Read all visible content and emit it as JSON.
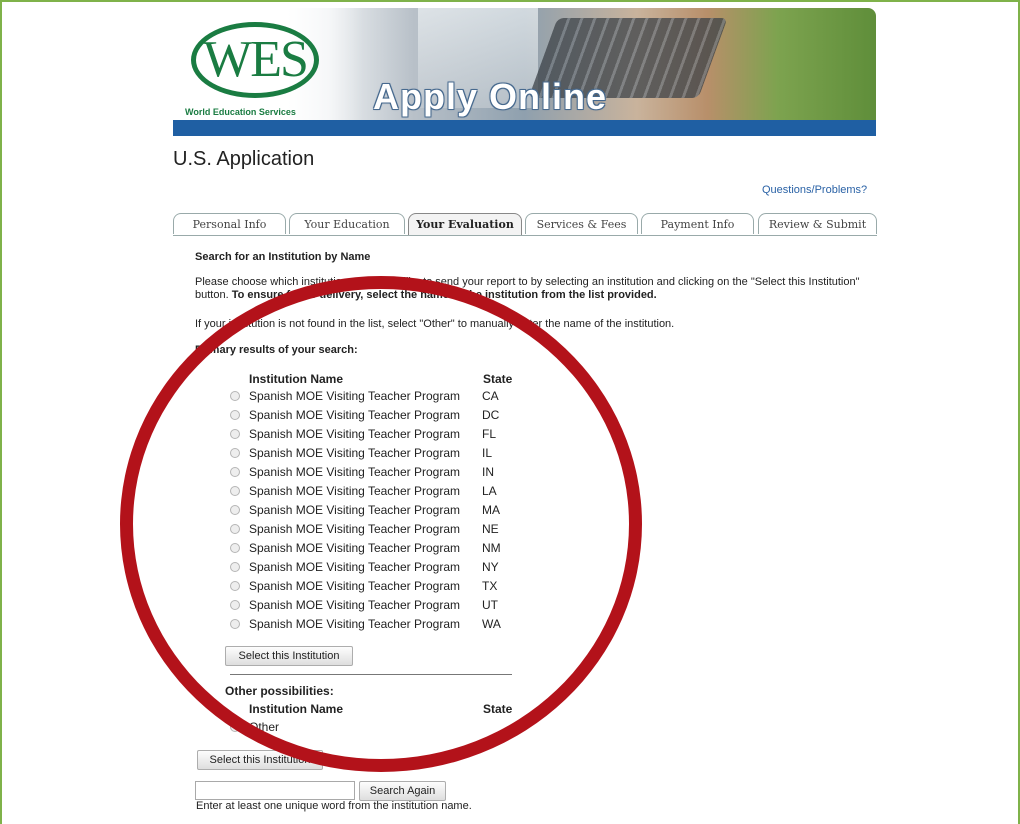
{
  "banner": {
    "logo_text": "WES",
    "logo_subtitle": "World Education Services",
    "title": "Apply Online"
  },
  "header": {
    "page_title": "U.S. Application",
    "help_link": "Questions/Problems?"
  },
  "tabs": [
    {
      "label": "Personal Info",
      "active": false
    },
    {
      "label": "Your Education",
      "active": false
    },
    {
      "label": "Your Evaluation",
      "active": true
    },
    {
      "label": "Services & Fees",
      "active": false
    },
    {
      "label": "Payment Info",
      "active": false
    },
    {
      "label": "Review & Submit",
      "active": false
    }
  ],
  "search": {
    "heading": "Search for an Institution by Name",
    "instructions_plain": "Please choose which institution you would like to send your report to by selecting an institution and clicking on the \"Select this Institution\" button.",
    "instructions_bold": "To ensure faster delivery, select the name of the institution from the list provided.",
    "other_note": "If your institution is not found in the list, select \"Other\" to manually enter the name of the institution.",
    "primary_heading": "Primary results of your search:",
    "col_name": "Institution Name",
    "col_state": "State",
    "results": [
      {
        "name": "Spanish MOE Visiting Teacher Program",
        "state": "CA"
      },
      {
        "name": "Spanish MOE Visiting Teacher Program",
        "state": "DC"
      },
      {
        "name": "Spanish MOE Visiting Teacher Program",
        "state": "FL"
      },
      {
        "name": "Spanish MOE Visiting Teacher Program",
        "state": "IL"
      },
      {
        "name": "Spanish MOE Visiting Teacher Program",
        "state": "IN"
      },
      {
        "name": "Spanish MOE Visiting Teacher Program",
        "state": "LA"
      },
      {
        "name": "Spanish MOE Visiting Teacher Program",
        "state": "MA"
      },
      {
        "name": "Spanish MOE Visiting Teacher Program",
        "state": "NE"
      },
      {
        "name": "Spanish MOE Visiting Teacher Program",
        "state": "NM"
      },
      {
        "name": "Spanish MOE Visiting Teacher Program",
        "state": "NY"
      },
      {
        "name": "Spanish MOE Visiting Teacher Program",
        "state": "TX"
      },
      {
        "name": "Spanish MOE Visiting Teacher Program",
        "state": "UT"
      },
      {
        "name": "Spanish MOE Visiting Teacher Program",
        "state": "WA"
      }
    ],
    "select_button": "Select this Institution",
    "other_heading": "Other possibilities:",
    "other_option": "Other",
    "select_button_2": "Select this Institution",
    "search_input_value": "",
    "search_again_button": "Search Again",
    "search_hint": "Enter at least one unique word from the institution name."
  },
  "colors": {
    "brand_green": "#1a7c42",
    "banner_stripe": "#1f5fa3",
    "link": "#2a62a6",
    "annotation_circle": "#b3121a",
    "frame_border": "#7fb24a"
  }
}
